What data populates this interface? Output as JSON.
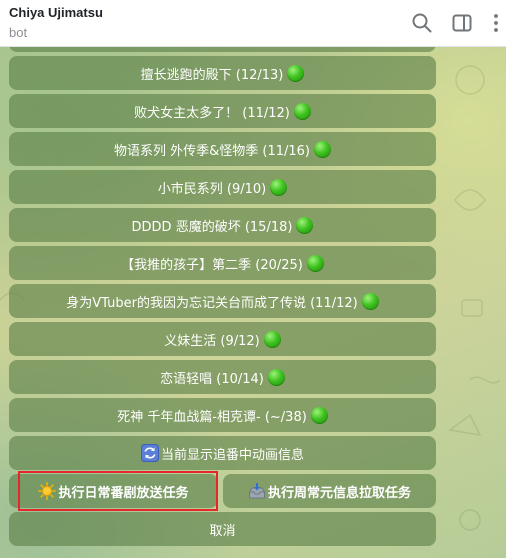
{
  "header": {
    "title": "Chiya Ujimatsu",
    "subtitle": "bot",
    "icons": [
      "search-icon",
      "sidebar-toggle-icon",
      "more-vertical-icon"
    ]
  },
  "keyboard": {
    "rows": [
      {
        "label": "擅长逃跑的殿下 (12/13)",
        "status": "green-circle"
      },
      {
        "label": "败犬女主太多了！ (11/12)",
        "status": "green-circle"
      },
      {
        "label": "物语系列 外传季&怪物季 (11/16)",
        "status": "green-circle"
      },
      {
        "label": "小市民系列 (9/10)",
        "status": "green-circle"
      },
      {
        "label": "DDDD 恶魔的破坏 (15/18)",
        "status": "green-circle"
      },
      {
        "label": "【我推的孩子】第二季 (20/25)",
        "status": "green-circle"
      },
      {
        "label": "身为VTuber的我因为忘记关台而成了传说 (11/12)",
        "status": "green-circle"
      },
      {
        "label": "义妹生活 (9/12)",
        "status": "green-circle"
      },
      {
        "label": "恋语轻唱 (10/14)",
        "status": "green-circle"
      },
      {
        "label": "死神 千年血战篇-相克谭- (~/38)",
        "status": "green-circle"
      }
    ],
    "refresh": {
      "label": "当前显示追番中动画信息",
      "icon": "refresh-icon"
    },
    "daily": {
      "label": "执行日常番剧放送任务",
      "icon": "sun-icon"
    },
    "weekly": {
      "label": "执行周常元信息拉取任务",
      "icon": "inbox-tray-icon"
    },
    "cancel": {
      "label": "取消"
    }
  },
  "colors": {
    "highlight": "#e5262b",
    "button_bg": "#5c8048",
    "status_green": "#3ec21e"
  }
}
